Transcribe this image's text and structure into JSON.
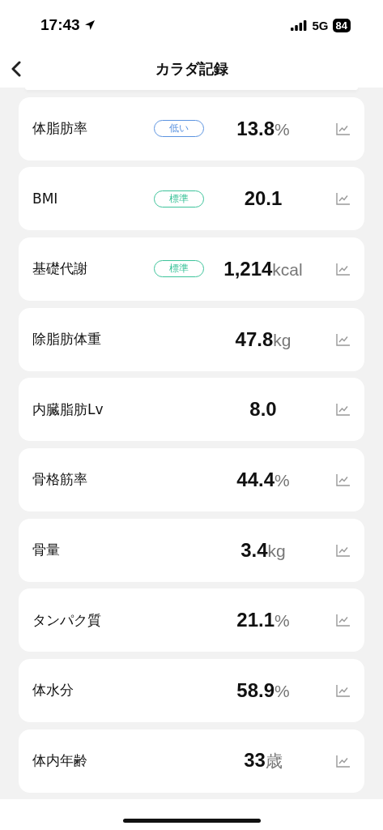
{
  "status_bar": {
    "time": "17:43",
    "network": "5G",
    "battery": "84"
  },
  "header": {
    "title": "カラダ記録"
  },
  "metrics": [
    {
      "name": "体脂肪率",
      "badge": {
        "text": "低い",
        "kind": "low"
      },
      "value": "13.8",
      "unit": "%"
    },
    {
      "name": "BMI",
      "badge": {
        "text": "標準",
        "kind": "normal"
      },
      "value": "20.1"
    },
    {
      "name": "基礎代謝",
      "badge": {
        "text": "標準",
        "kind": "normal"
      },
      "value": "1,214",
      "unit": "kcal"
    },
    {
      "name": "除脂肪体重",
      "value": "47.8",
      "unit": "kg"
    },
    {
      "name": "内臓脂肪Lv",
      "value": "8.0"
    },
    {
      "name": "骨格筋率",
      "value": "44.4",
      "unit": "%"
    },
    {
      "name": "骨量",
      "value": "3.4",
      "unit": "kg"
    },
    {
      "name": "タンパク質",
      "value": "21.1",
      "unit": "%"
    },
    {
      "name": "体水分",
      "value": "58.9",
      "unit": "%"
    },
    {
      "name": "体内年齢",
      "value": "33",
      "unit": "歳"
    }
  ]
}
